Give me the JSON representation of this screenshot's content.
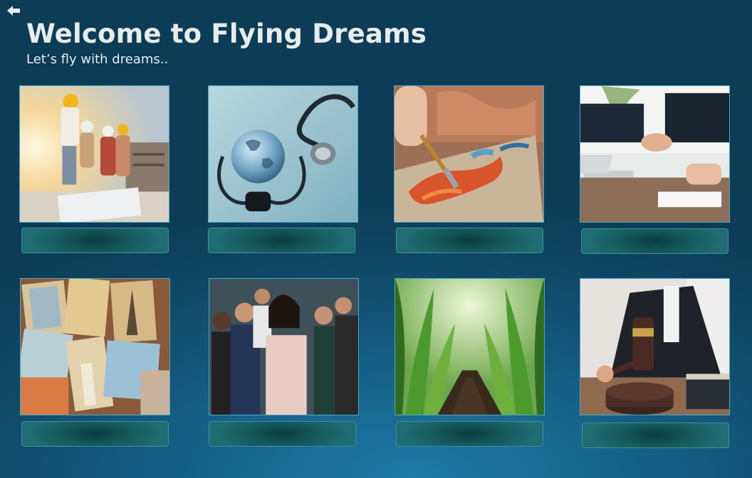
{
  "header": {
    "back_icon": "arrow-left-icon",
    "title": "Welcome to Flying Dreams",
    "subtitle": "Let’s fly with dreams.."
  },
  "colors": {
    "background": "#135a7e",
    "title_text": "#e8ecec",
    "tile_border": "#4aa9c4",
    "caption_bar": "#1a6268"
  },
  "cards": [
    {
      "id": "engineering",
      "image": "engineers-in-hard-hats-image",
      "caption": ""
    },
    {
      "id": "medicine",
      "image": "globe-and-stethoscope-image",
      "caption": ""
    },
    {
      "id": "arts",
      "image": "painting-brush-image",
      "caption": ""
    },
    {
      "id": "business",
      "image": "business-handshake-image",
      "caption": ""
    },
    {
      "id": "tourism",
      "image": "travel-postcards-image",
      "caption": ""
    },
    {
      "id": "management",
      "image": "team-thumbs-up-image",
      "caption": ""
    },
    {
      "id": "agriculture",
      "image": "corn-field-image",
      "caption": ""
    },
    {
      "id": "law",
      "image": "judge-gavel-image",
      "caption": ""
    }
  ]
}
